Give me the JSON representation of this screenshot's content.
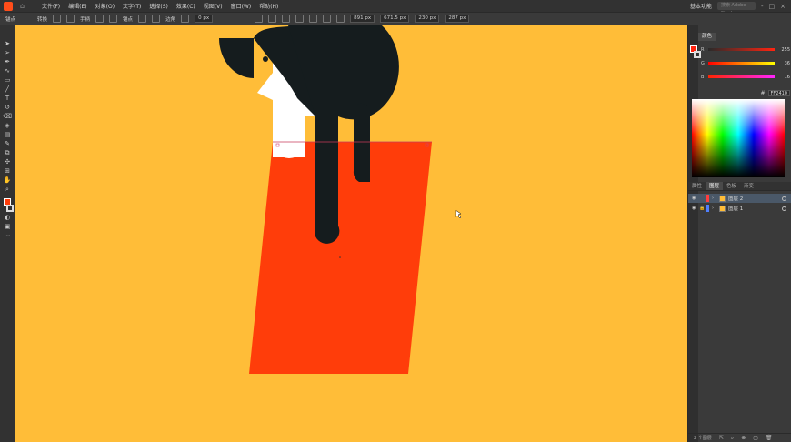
{
  "menubar": {
    "menus": [
      "文件(F)",
      "编辑(E)",
      "对象(O)",
      "文字(T)",
      "选择(S)",
      "效果(C)",
      "视图(V)",
      "窗口(W)",
      "帮助(H)"
    ],
    "workspace": "基本功能",
    "search_placeholder": "搜索 Adobe Stock",
    "window_controls": [
      "-",
      "□",
      "×"
    ]
  },
  "control": {
    "anchor_label": "锚点",
    "convert_label": "转换",
    "handle_label": "手柄",
    "anchor2_label": "锚点",
    "corner_label": "边角",
    "corner_value": "0 px",
    "x_value": "891 px",
    "y_value": "671.5 px",
    "w_value": "230 px",
    "h_value": "287 px"
  },
  "color_panel": {
    "tab": "颜色",
    "r_value": "255",
    "g_value": "36",
    "b_value": "16",
    "hex": "FF2410",
    "r_color": "#ff2410"
  },
  "layers_panel": {
    "tabs": [
      "属性",
      "图层",
      "色板",
      "渐变"
    ],
    "layers": [
      {
        "name": "图层 2",
        "color": "#ff3d3d"
      },
      {
        "name": "图层 1",
        "color": "#4f7fff"
      }
    ],
    "footer": "2 个图层"
  },
  "canvas": {
    "background": "#ffbd38",
    "hair_color": "#151c1e",
    "skin_color": "#ffffff",
    "dress_color": "#ff3d0a"
  }
}
